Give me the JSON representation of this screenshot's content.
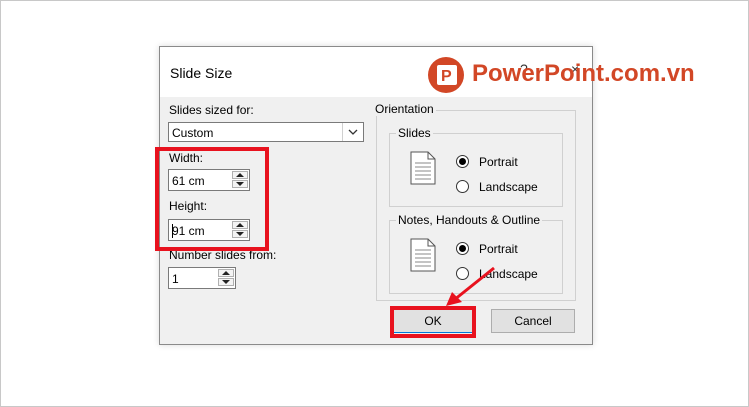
{
  "dialog": {
    "title": "Slide Size",
    "help_symbol": "?",
    "close_symbol": "×",
    "slides_sized_for_label": "Slides sized for:",
    "slides_sized_for_value": "Custom",
    "width_label": "Width:",
    "width_value": "61 cm",
    "height_label": "Height:",
    "height_value": "91 cm",
    "number_slides_label": "Number slides from:",
    "number_slides_value": "1",
    "orientation_label": "Orientation",
    "slides_group_label": "Slides",
    "notes_group_label": "Notes, Handouts & Outline",
    "portrait_label": "Portrait",
    "landscape_label": "Landscape",
    "ok_label": "OK",
    "cancel_label": "Cancel"
  },
  "watermark": {
    "text": "PowerPoint.com.vn",
    "color": "#d24726"
  },
  "annotation": {
    "color": "#e8121e"
  }
}
